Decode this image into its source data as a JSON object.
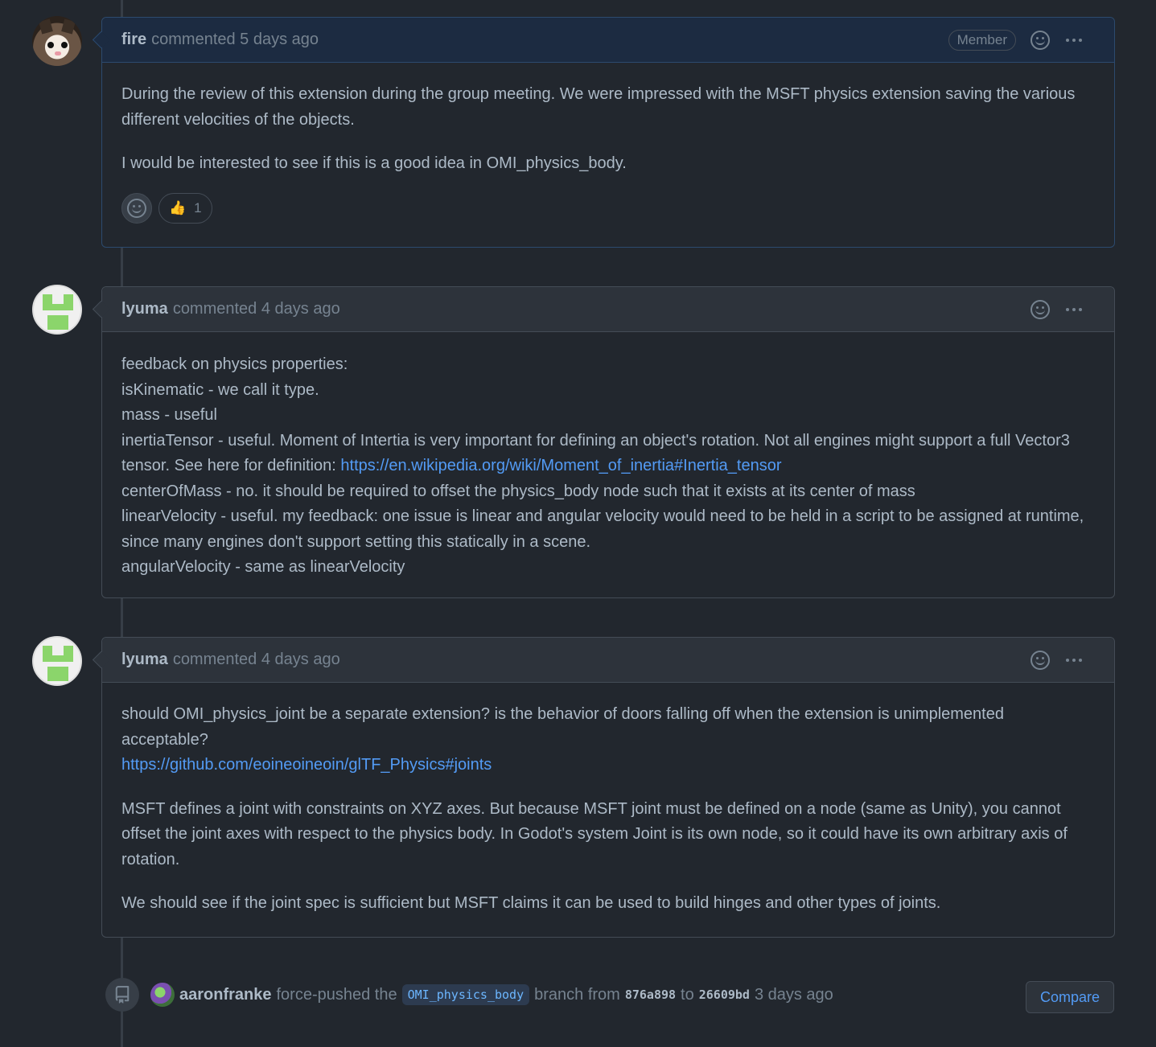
{
  "comments": [
    {
      "author": "fire",
      "meta": "commented 5 days ago",
      "badge": "Member",
      "paragraphs": [
        "During the review of this extension during the group meeting. We were impressed with the MSFT physics extension saving the various different velocities of the objects.",
        "I would be interested to see if this is a good idea in OMI_physics_body."
      ],
      "reaction": {
        "emoji": "👍",
        "count": "1"
      }
    },
    {
      "author": "lyuma",
      "meta": "commented 4 days ago",
      "lines": {
        "l1": "feedback on physics properties:",
        "l2": "isKinematic - we call it type.",
        "l3": "mass - useful",
        "l4": "inertiaTensor - useful. Moment of Intertia is very important for defining an object's rotation. Not all engines might support a full Vector3 tensor. See here for definition: ",
        "l4_link": "https://en.wikipedia.org/wiki/Moment_of_inertia#Inertia_tensor",
        "l5": "centerOfMass - no. it should be required to offset the physics_body node such that it exists at its center of mass",
        "l6": "linearVelocity - useful. my feedback: one issue is linear and angular velocity would need to be held in a script to be assigned at runtime, since many engines don't support setting this statically in a scene.",
        "l7": "angularVelocity - same as linearVelocity"
      }
    },
    {
      "author": "lyuma",
      "meta": "commented 4 days ago",
      "p1": "should OMI_physics_joint be a separate extension? is the behavior of doors falling off when the extension is unimplemented acceptable?",
      "p1_link": "https://github.com/eoineoineoin/glTF_Physics#joints",
      "p2": "MSFT defines a joint with constraints on XYZ axes. But because MSFT joint must be defined on a node (same as Unity), you cannot offset the joint axes with respect to the physics body. In Godot's system Joint is its own node, so it could have its own arbitrary axis of rotation.",
      "p3": "We should see if the joint spec is sufficient but MSFT claims it can be used to build hinges and other types of joints."
    }
  ],
  "event": {
    "actor": "aaronfranke",
    "action": "force-pushed the",
    "branch": "OMI_physics_body",
    "from_text": "branch from",
    "from_sha": "876a898",
    "to_text": "to",
    "to_sha": "26609bd",
    "time": "3 days ago",
    "compare_label": "Compare"
  },
  "icons": {
    "emoji_picker": "smiley-icon",
    "more": "kebab-icon",
    "push": "repo-push-icon"
  },
  "colors": {
    "background": "#22272e",
    "link": "#539bf5",
    "member_border": "#2c4a6e"
  }
}
